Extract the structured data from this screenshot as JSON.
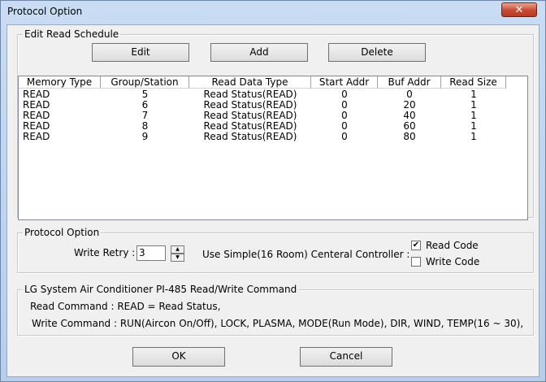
{
  "window": {
    "title": "Protocol Option",
    "close_glyph": "✕"
  },
  "schedule": {
    "legend": "Edit Read Schedule",
    "buttons": {
      "edit": "Edit",
      "add": "Add",
      "delete": "Delete"
    },
    "columns": [
      "Memory Type",
      "Group/Station",
      "Read Data Type",
      "Start Addr",
      "Buf Addr",
      "Read Size"
    ],
    "rows": [
      [
        "READ",
        "5",
        "Read Status(READ)",
        "0",
        "0",
        "1"
      ],
      [
        "READ",
        "6",
        "Read Status(READ)",
        "0",
        "20",
        "1"
      ],
      [
        "READ",
        "7",
        "Read Status(READ)",
        "0",
        "40",
        "1"
      ],
      [
        "READ",
        "8",
        "Read Status(READ)",
        "0",
        "60",
        "1"
      ],
      [
        "READ",
        "9",
        "Read Status(READ)",
        "0",
        "80",
        "1"
      ]
    ]
  },
  "protocol": {
    "legend": "Protocol Option",
    "write_retry_label": "Write Retry :",
    "write_retry_value": "3",
    "controller_label": "Use Simple(16 Room) Centeral Controller :",
    "read_code_label": "Read Code",
    "read_code_checked": true,
    "write_code_label": "Write Code",
    "write_code_checked": false
  },
  "command": {
    "legend": "LG System Air Conditioner PI-485 Read/Write Command",
    "read_line": "Read Command : READ = Read Status,",
    "write_line": "Write Command : RUN(Aircon On/Off), LOCK, PLASMA, MODE(Run Mode), DIR, WIND, TEMP(16 ~ 30),"
  },
  "footer": {
    "ok": "OK",
    "cancel": "Cancel"
  },
  "icons": {
    "check": "✔",
    "up": "▲",
    "down": "▼"
  }
}
